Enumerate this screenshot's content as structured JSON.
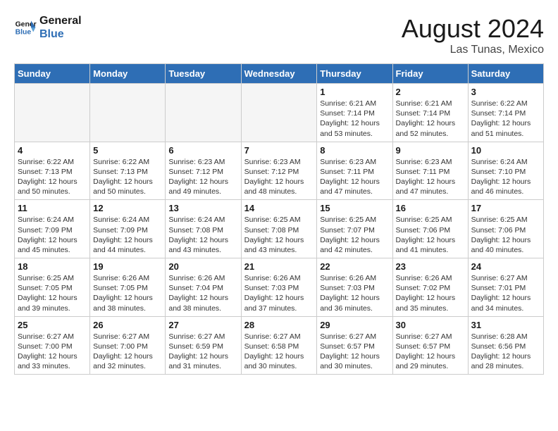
{
  "header": {
    "logo_line1": "General",
    "logo_line2": "Blue",
    "month_year": "August 2024",
    "location": "Las Tunas, Mexico"
  },
  "weekdays": [
    "Sunday",
    "Monday",
    "Tuesday",
    "Wednesday",
    "Thursday",
    "Friday",
    "Saturday"
  ],
  "weeks": [
    [
      {
        "day": "",
        "info": ""
      },
      {
        "day": "",
        "info": ""
      },
      {
        "day": "",
        "info": ""
      },
      {
        "day": "",
        "info": ""
      },
      {
        "day": "1",
        "info": "Sunrise: 6:21 AM\nSunset: 7:14 PM\nDaylight: 12 hours\nand 53 minutes."
      },
      {
        "day": "2",
        "info": "Sunrise: 6:21 AM\nSunset: 7:14 PM\nDaylight: 12 hours\nand 52 minutes."
      },
      {
        "day": "3",
        "info": "Sunrise: 6:22 AM\nSunset: 7:14 PM\nDaylight: 12 hours\nand 51 minutes."
      }
    ],
    [
      {
        "day": "4",
        "info": "Sunrise: 6:22 AM\nSunset: 7:13 PM\nDaylight: 12 hours\nand 50 minutes."
      },
      {
        "day": "5",
        "info": "Sunrise: 6:22 AM\nSunset: 7:13 PM\nDaylight: 12 hours\nand 50 minutes."
      },
      {
        "day": "6",
        "info": "Sunrise: 6:23 AM\nSunset: 7:12 PM\nDaylight: 12 hours\nand 49 minutes."
      },
      {
        "day": "7",
        "info": "Sunrise: 6:23 AM\nSunset: 7:12 PM\nDaylight: 12 hours\nand 48 minutes."
      },
      {
        "day": "8",
        "info": "Sunrise: 6:23 AM\nSunset: 7:11 PM\nDaylight: 12 hours\nand 47 minutes."
      },
      {
        "day": "9",
        "info": "Sunrise: 6:23 AM\nSunset: 7:11 PM\nDaylight: 12 hours\nand 47 minutes."
      },
      {
        "day": "10",
        "info": "Sunrise: 6:24 AM\nSunset: 7:10 PM\nDaylight: 12 hours\nand 46 minutes."
      }
    ],
    [
      {
        "day": "11",
        "info": "Sunrise: 6:24 AM\nSunset: 7:09 PM\nDaylight: 12 hours\nand 45 minutes."
      },
      {
        "day": "12",
        "info": "Sunrise: 6:24 AM\nSunset: 7:09 PM\nDaylight: 12 hours\nand 44 minutes."
      },
      {
        "day": "13",
        "info": "Sunrise: 6:24 AM\nSunset: 7:08 PM\nDaylight: 12 hours\nand 43 minutes."
      },
      {
        "day": "14",
        "info": "Sunrise: 6:25 AM\nSunset: 7:08 PM\nDaylight: 12 hours\nand 43 minutes."
      },
      {
        "day": "15",
        "info": "Sunrise: 6:25 AM\nSunset: 7:07 PM\nDaylight: 12 hours\nand 42 minutes."
      },
      {
        "day": "16",
        "info": "Sunrise: 6:25 AM\nSunset: 7:06 PM\nDaylight: 12 hours\nand 41 minutes."
      },
      {
        "day": "17",
        "info": "Sunrise: 6:25 AM\nSunset: 7:06 PM\nDaylight: 12 hours\nand 40 minutes."
      }
    ],
    [
      {
        "day": "18",
        "info": "Sunrise: 6:25 AM\nSunset: 7:05 PM\nDaylight: 12 hours\nand 39 minutes."
      },
      {
        "day": "19",
        "info": "Sunrise: 6:26 AM\nSunset: 7:05 PM\nDaylight: 12 hours\nand 38 minutes."
      },
      {
        "day": "20",
        "info": "Sunrise: 6:26 AM\nSunset: 7:04 PM\nDaylight: 12 hours\nand 38 minutes."
      },
      {
        "day": "21",
        "info": "Sunrise: 6:26 AM\nSunset: 7:03 PM\nDaylight: 12 hours\nand 37 minutes."
      },
      {
        "day": "22",
        "info": "Sunrise: 6:26 AM\nSunset: 7:03 PM\nDaylight: 12 hours\nand 36 minutes."
      },
      {
        "day": "23",
        "info": "Sunrise: 6:26 AM\nSunset: 7:02 PM\nDaylight: 12 hours\nand 35 minutes."
      },
      {
        "day": "24",
        "info": "Sunrise: 6:27 AM\nSunset: 7:01 PM\nDaylight: 12 hours\nand 34 minutes."
      }
    ],
    [
      {
        "day": "25",
        "info": "Sunrise: 6:27 AM\nSunset: 7:00 PM\nDaylight: 12 hours\nand 33 minutes."
      },
      {
        "day": "26",
        "info": "Sunrise: 6:27 AM\nSunset: 7:00 PM\nDaylight: 12 hours\nand 32 minutes."
      },
      {
        "day": "27",
        "info": "Sunrise: 6:27 AM\nSunset: 6:59 PM\nDaylight: 12 hours\nand 31 minutes."
      },
      {
        "day": "28",
        "info": "Sunrise: 6:27 AM\nSunset: 6:58 PM\nDaylight: 12 hours\nand 30 minutes."
      },
      {
        "day": "29",
        "info": "Sunrise: 6:27 AM\nSunset: 6:57 PM\nDaylight: 12 hours\nand 30 minutes."
      },
      {
        "day": "30",
        "info": "Sunrise: 6:27 AM\nSunset: 6:57 PM\nDaylight: 12 hours\nand 29 minutes."
      },
      {
        "day": "31",
        "info": "Sunrise: 6:28 AM\nSunset: 6:56 PM\nDaylight: 12 hours\nand 28 minutes."
      }
    ]
  ]
}
